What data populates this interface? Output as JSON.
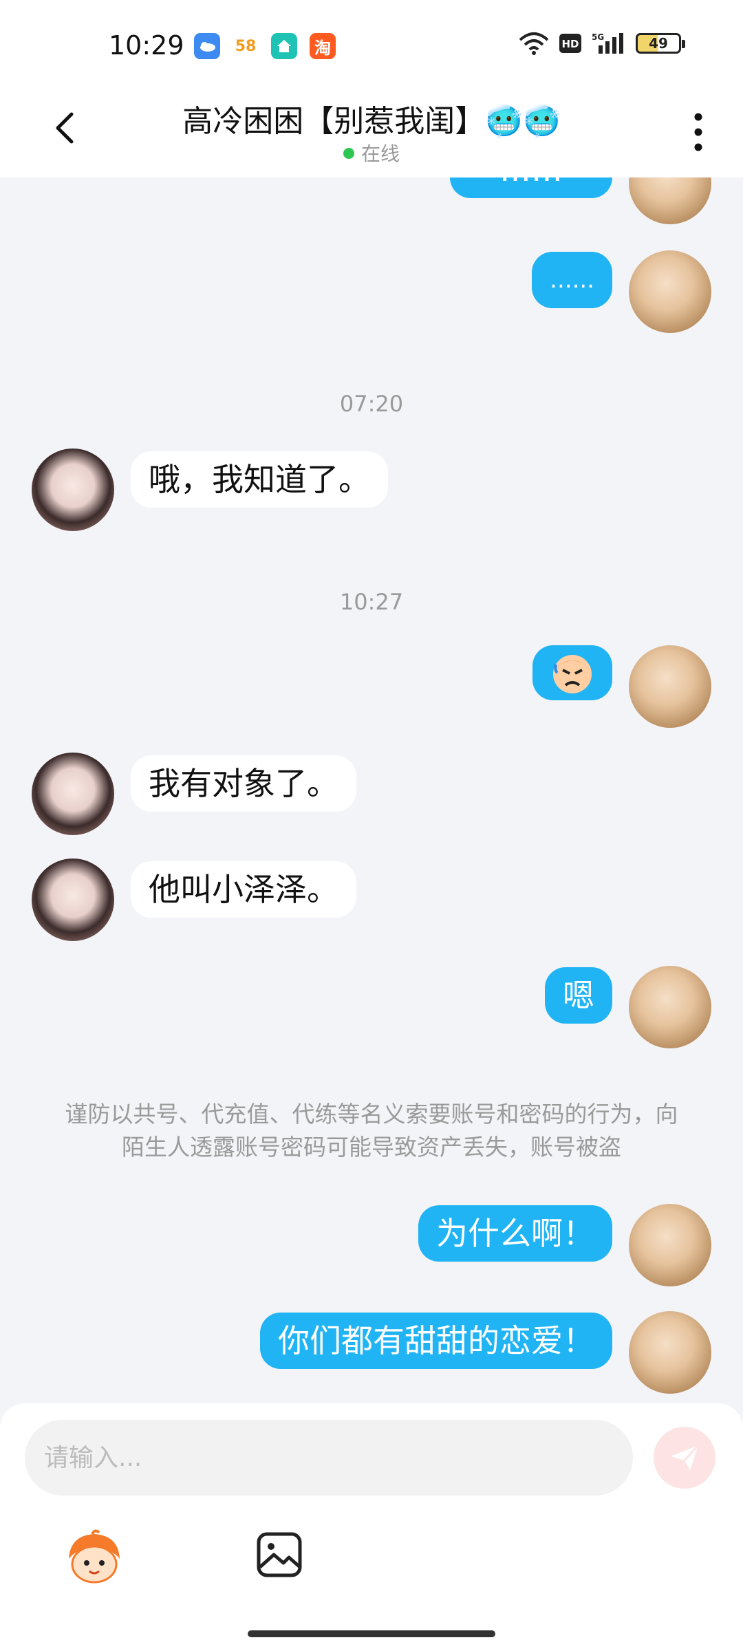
{
  "status_bar": {
    "time": "10:29",
    "app_icons": [
      "weather-icon",
      "58-icon",
      "home-app-icon",
      "taobao-icon"
    ],
    "app_58_label": "58",
    "app_taobao_label": "淘",
    "battery": "49"
  },
  "header": {
    "title": "高冷困困【别惹我闺】🥶🥶",
    "status": "在线"
  },
  "chat": {
    "partial_message": "……",
    "msg_dots": "......",
    "time_1": "07:20",
    "msg_1": "哦，我知道了。",
    "time_2": "10:27",
    "msg_3": "我有对象了。",
    "msg_4": "他叫小泽泽。",
    "msg_5": "嗯",
    "notice": "谨防以共号、代充值、代练等名义索要账号和密码的行为，向陌生人透露账号密码可能导致资产丢失，账号被盗",
    "msg_6": "为什么啊！",
    "msg_7": "你们都有甜甜的恋爱！"
  },
  "input": {
    "placeholder": "请输入..."
  },
  "colors": {
    "bubble_me": "#21b4f5",
    "bubble_her": "#ffffff",
    "online": "#2dc653",
    "send_btn": "#fde3e3"
  }
}
